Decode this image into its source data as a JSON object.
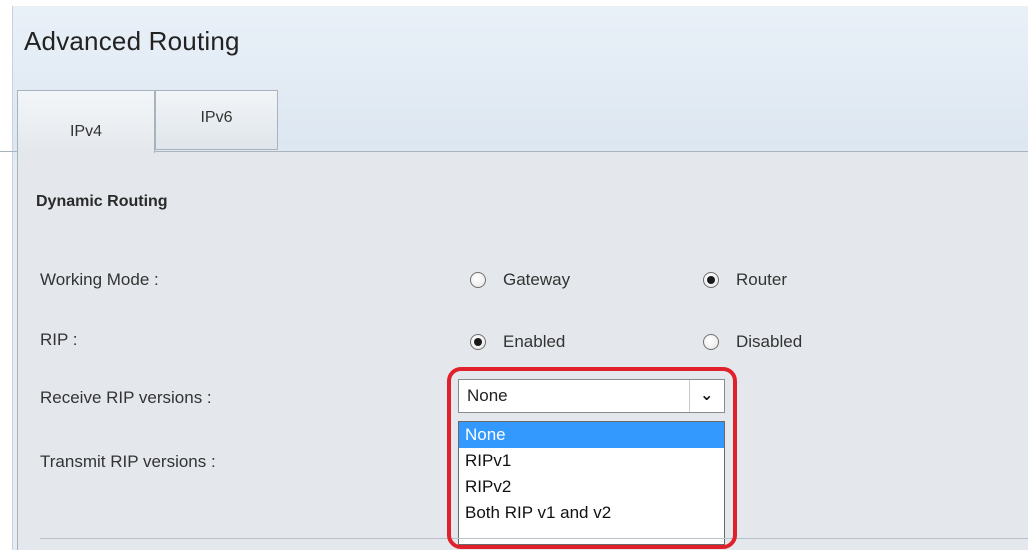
{
  "page": {
    "title": "Advanced Routing"
  },
  "tabs": [
    {
      "label": "IPv4",
      "active": true
    },
    {
      "label": "IPv6",
      "active": false
    }
  ],
  "section": {
    "title": "Dynamic Routing"
  },
  "working_mode": {
    "label": "Working Mode :",
    "options": [
      {
        "label": "Gateway",
        "checked": false
      },
      {
        "label": "Router",
        "checked": true
      }
    ]
  },
  "rip": {
    "label": "RIP :",
    "options": [
      {
        "label": "Enabled",
        "checked": true
      },
      {
        "label": "Disabled",
        "checked": false
      }
    ]
  },
  "receive_rip": {
    "label": "Receive RIP versions :",
    "selected": "None",
    "options": [
      "None",
      "RIPv1",
      "RIPv2",
      "Both RIP v1 and v2"
    ],
    "highlighted_option": "None"
  },
  "transmit_rip": {
    "label": "Transmit RIP versions :"
  },
  "icons": {
    "dropdown_arrow": "chevron-down-icon"
  },
  "colors": {
    "highlight_ring": "#e0202a",
    "selected_option_bg": "#3399ff"
  }
}
